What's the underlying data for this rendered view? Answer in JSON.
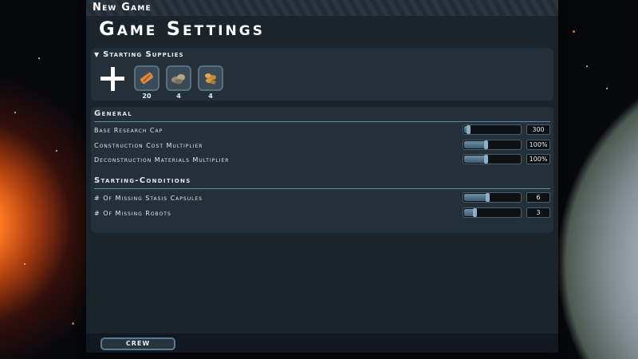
{
  "window": {
    "subtitle": "New Game",
    "title": "Game Settings"
  },
  "supplies": {
    "header": "Starting Supplies",
    "items": [
      {
        "icon": "ration-bar-icon",
        "count": "20"
      },
      {
        "icon": "rocks-icon",
        "count": "4"
      },
      {
        "icon": "food-pile-icon",
        "count": "4"
      }
    ]
  },
  "sections": {
    "general": {
      "header": "General",
      "rows": [
        {
          "label": "Base Research Cap",
          "value": "300",
          "level": 0.05
        },
        {
          "label": "Construction Cost Multiplier",
          "value": "100%",
          "level": 0.4
        },
        {
          "label": "Deconstruction Materials Multiplier",
          "value": "100%",
          "level": 0.4
        }
      ]
    },
    "starting_conditions": {
      "header": "Starting-Conditions",
      "rows": [
        {
          "label": "# Of Missing Stasis Capsules",
          "value": "6",
          "level": 0.43
        },
        {
          "label": "# Of Missing Robots",
          "value": "3",
          "level": 0.2
        }
      ]
    }
  },
  "footer": {
    "crew_label": "CREW"
  }
}
